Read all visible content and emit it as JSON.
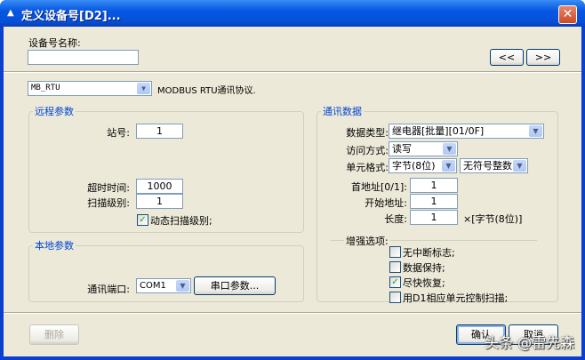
{
  "window": {
    "title": "定义设备号[D2]...",
    "close": "✕"
  },
  "device_name": {
    "label": "设备号名称:",
    "value": ""
  },
  "nav": {
    "prev": "<<",
    "next": ">>"
  },
  "protocol": {
    "value": "MB_RTU",
    "description": "MODBUS RTU通讯协议."
  },
  "remote": {
    "legend": "远程参数",
    "station_label": "站号:",
    "station": "1",
    "timeout_label": "超时时间:",
    "timeout": "1000",
    "scan_label": "扫描级别:",
    "scan": "1",
    "dynamic_scan_label": "动态扫描级别;",
    "dynamic_scan": true
  },
  "local": {
    "legend": "本地参数",
    "port_label": "通讯端口:",
    "port": "COM1",
    "serial_button": "串口参数..."
  },
  "comm": {
    "legend": "通讯数据",
    "data_type_label": "数据类型:",
    "data_type": "继电器[批量][01/0F]",
    "access_label": "访问方式:",
    "access": "读写",
    "format_label": "单元格式:",
    "format": "字节(8位)",
    "sign": "无符号整数",
    "first_addr_label": "首地址[0/1]:",
    "first_addr": "1",
    "start_addr_label": "开始地址:",
    "start_addr": "1",
    "length_label": "长度:",
    "length": "1",
    "length_unit": "×[字节(8位)]"
  },
  "enhanced": {
    "label": "增强选项:",
    "options": [
      {
        "label": "无中断标志;",
        "checked": false
      },
      {
        "label": "数据保持;",
        "checked": false
      },
      {
        "label": "尽快恢复;",
        "checked": true
      },
      {
        "label": "用D1相应单元控制扫描;",
        "checked": false
      }
    ]
  },
  "footer": {
    "delete": "删除",
    "ok": "确认",
    "cancel": "取消"
  },
  "watermark": "头条 @雷先森"
}
